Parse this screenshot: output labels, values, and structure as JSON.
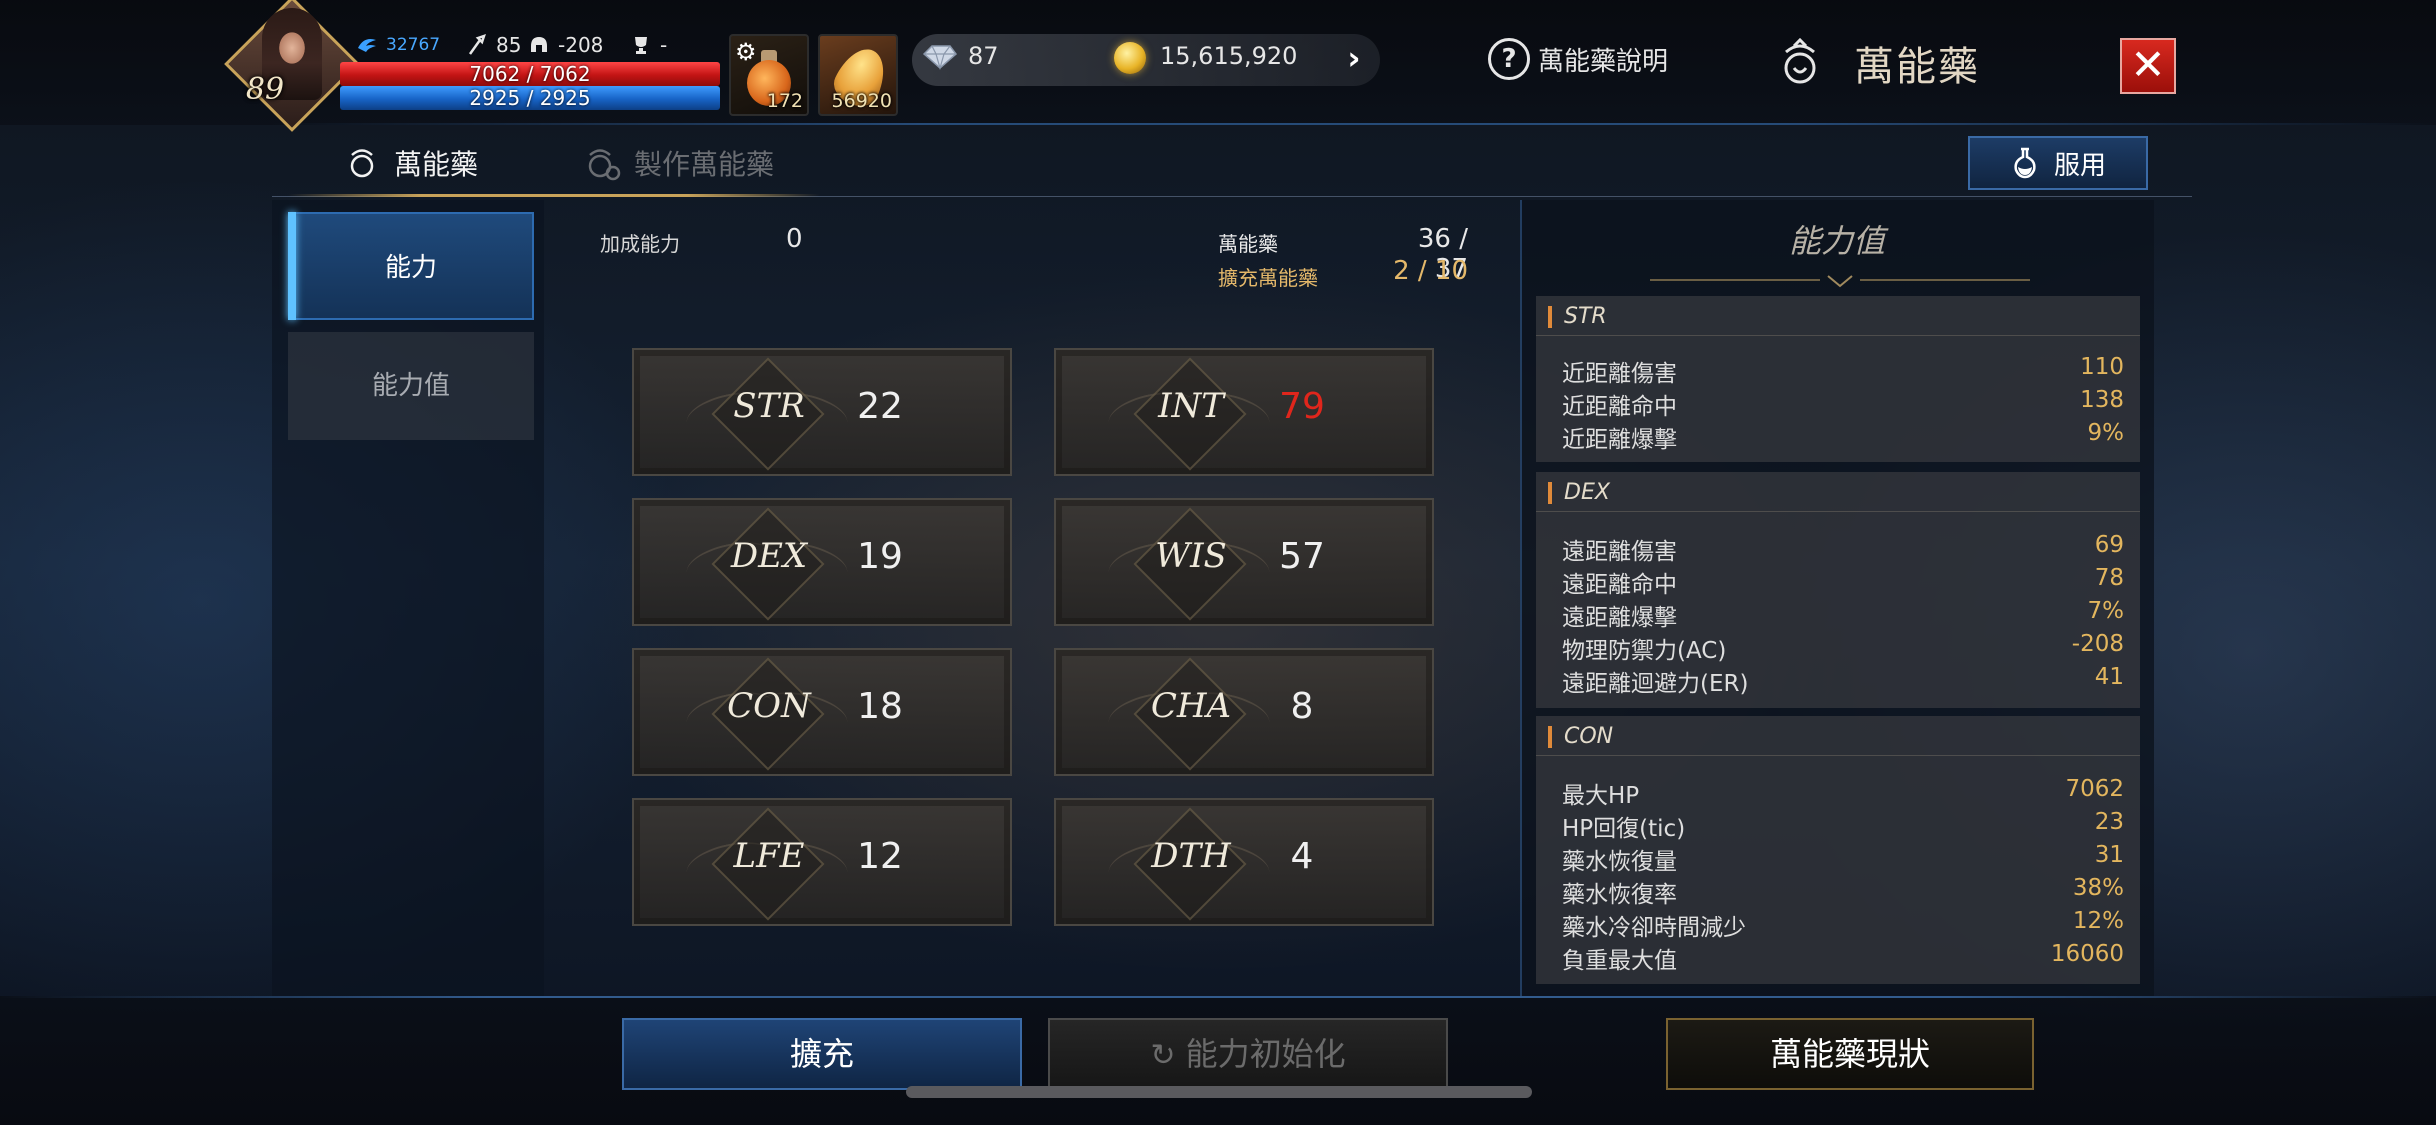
{
  "hud": {
    "level": "89",
    "rank": "32767",
    "attack": "85",
    "defense": "-208",
    "trophy": "-",
    "hp": "7062 / 7062",
    "mp": "2925 / 2925",
    "slot1_qty": "172",
    "slot2_qty": "56920",
    "diamonds": "87",
    "gold": "15,615,920",
    "help_label": "萬能藥說明",
    "title": "萬能藥",
    "close": "✕"
  },
  "tabs": {
    "tab1": "萬能藥",
    "tab2": "製作萬能藥",
    "use_button": "服用"
  },
  "nav": {
    "item1": "能力",
    "item2": "能力值"
  },
  "info": {
    "bonus_label": "加成能力",
    "bonus_value": "0",
    "potion_label": "萬能藥",
    "potion_value": "36 / 37",
    "extended_label": "擴充萬能藥",
    "extended_value": "2 / 10"
  },
  "stats": [
    {
      "name": "STR",
      "value": "22"
    },
    {
      "name": "INT",
      "value": "79"
    },
    {
      "name": "DEX",
      "value": "19"
    },
    {
      "name": "WIS",
      "value": "57"
    },
    {
      "name": "CON",
      "value": "18"
    },
    {
      "name": "CHA",
      "value": "8"
    },
    {
      "name": "LFE",
      "value": "12"
    },
    {
      "name": "DTH",
      "value": "4"
    }
  ],
  "panel": {
    "title": "能力值",
    "str": {
      "name": "STR",
      "rows": [
        {
          "k": "近距離傷害",
          "v": "110"
        },
        {
          "k": "近距離命中",
          "v": "138"
        },
        {
          "k": "近距離爆擊",
          "v": "9%"
        }
      ]
    },
    "dex": {
      "name": "DEX",
      "rows": [
        {
          "k": "遠距離傷害",
          "v": "69"
        },
        {
          "k": "遠距離命中",
          "v": "78"
        },
        {
          "k": "遠距離爆擊",
          "v": "7%"
        },
        {
          "k": "物理防禦力(AC)",
          "v": "-208"
        },
        {
          "k": "遠距離迴避力(ER)",
          "v": "41"
        }
      ]
    },
    "con": {
      "name": "CON",
      "rows": [
        {
          "k": "最大HP",
          "v": "7062"
        },
        {
          "k": "HP回復(tic)",
          "v": "23"
        },
        {
          "k": "藥水恢復量",
          "v": "31"
        },
        {
          "k": "藥水恢復率",
          "v": "38%"
        },
        {
          "k": "藥水冷卻時間減少",
          "v": "12%"
        },
        {
          "k": "負重最大值",
          "v": "16060"
        }
      ]
    }
  },
  "buttons": {
    "expand": "擴充",
    "reset": "能力初始化",
    "status": "萬能藥現狀"
  },
  "colors": {
    "hp": "#d81b1b",
    "mp": "#1e6fd6",
    "highlight_value": "#e0261c",
    "gold_text": "#e3b65e"
  }
}
